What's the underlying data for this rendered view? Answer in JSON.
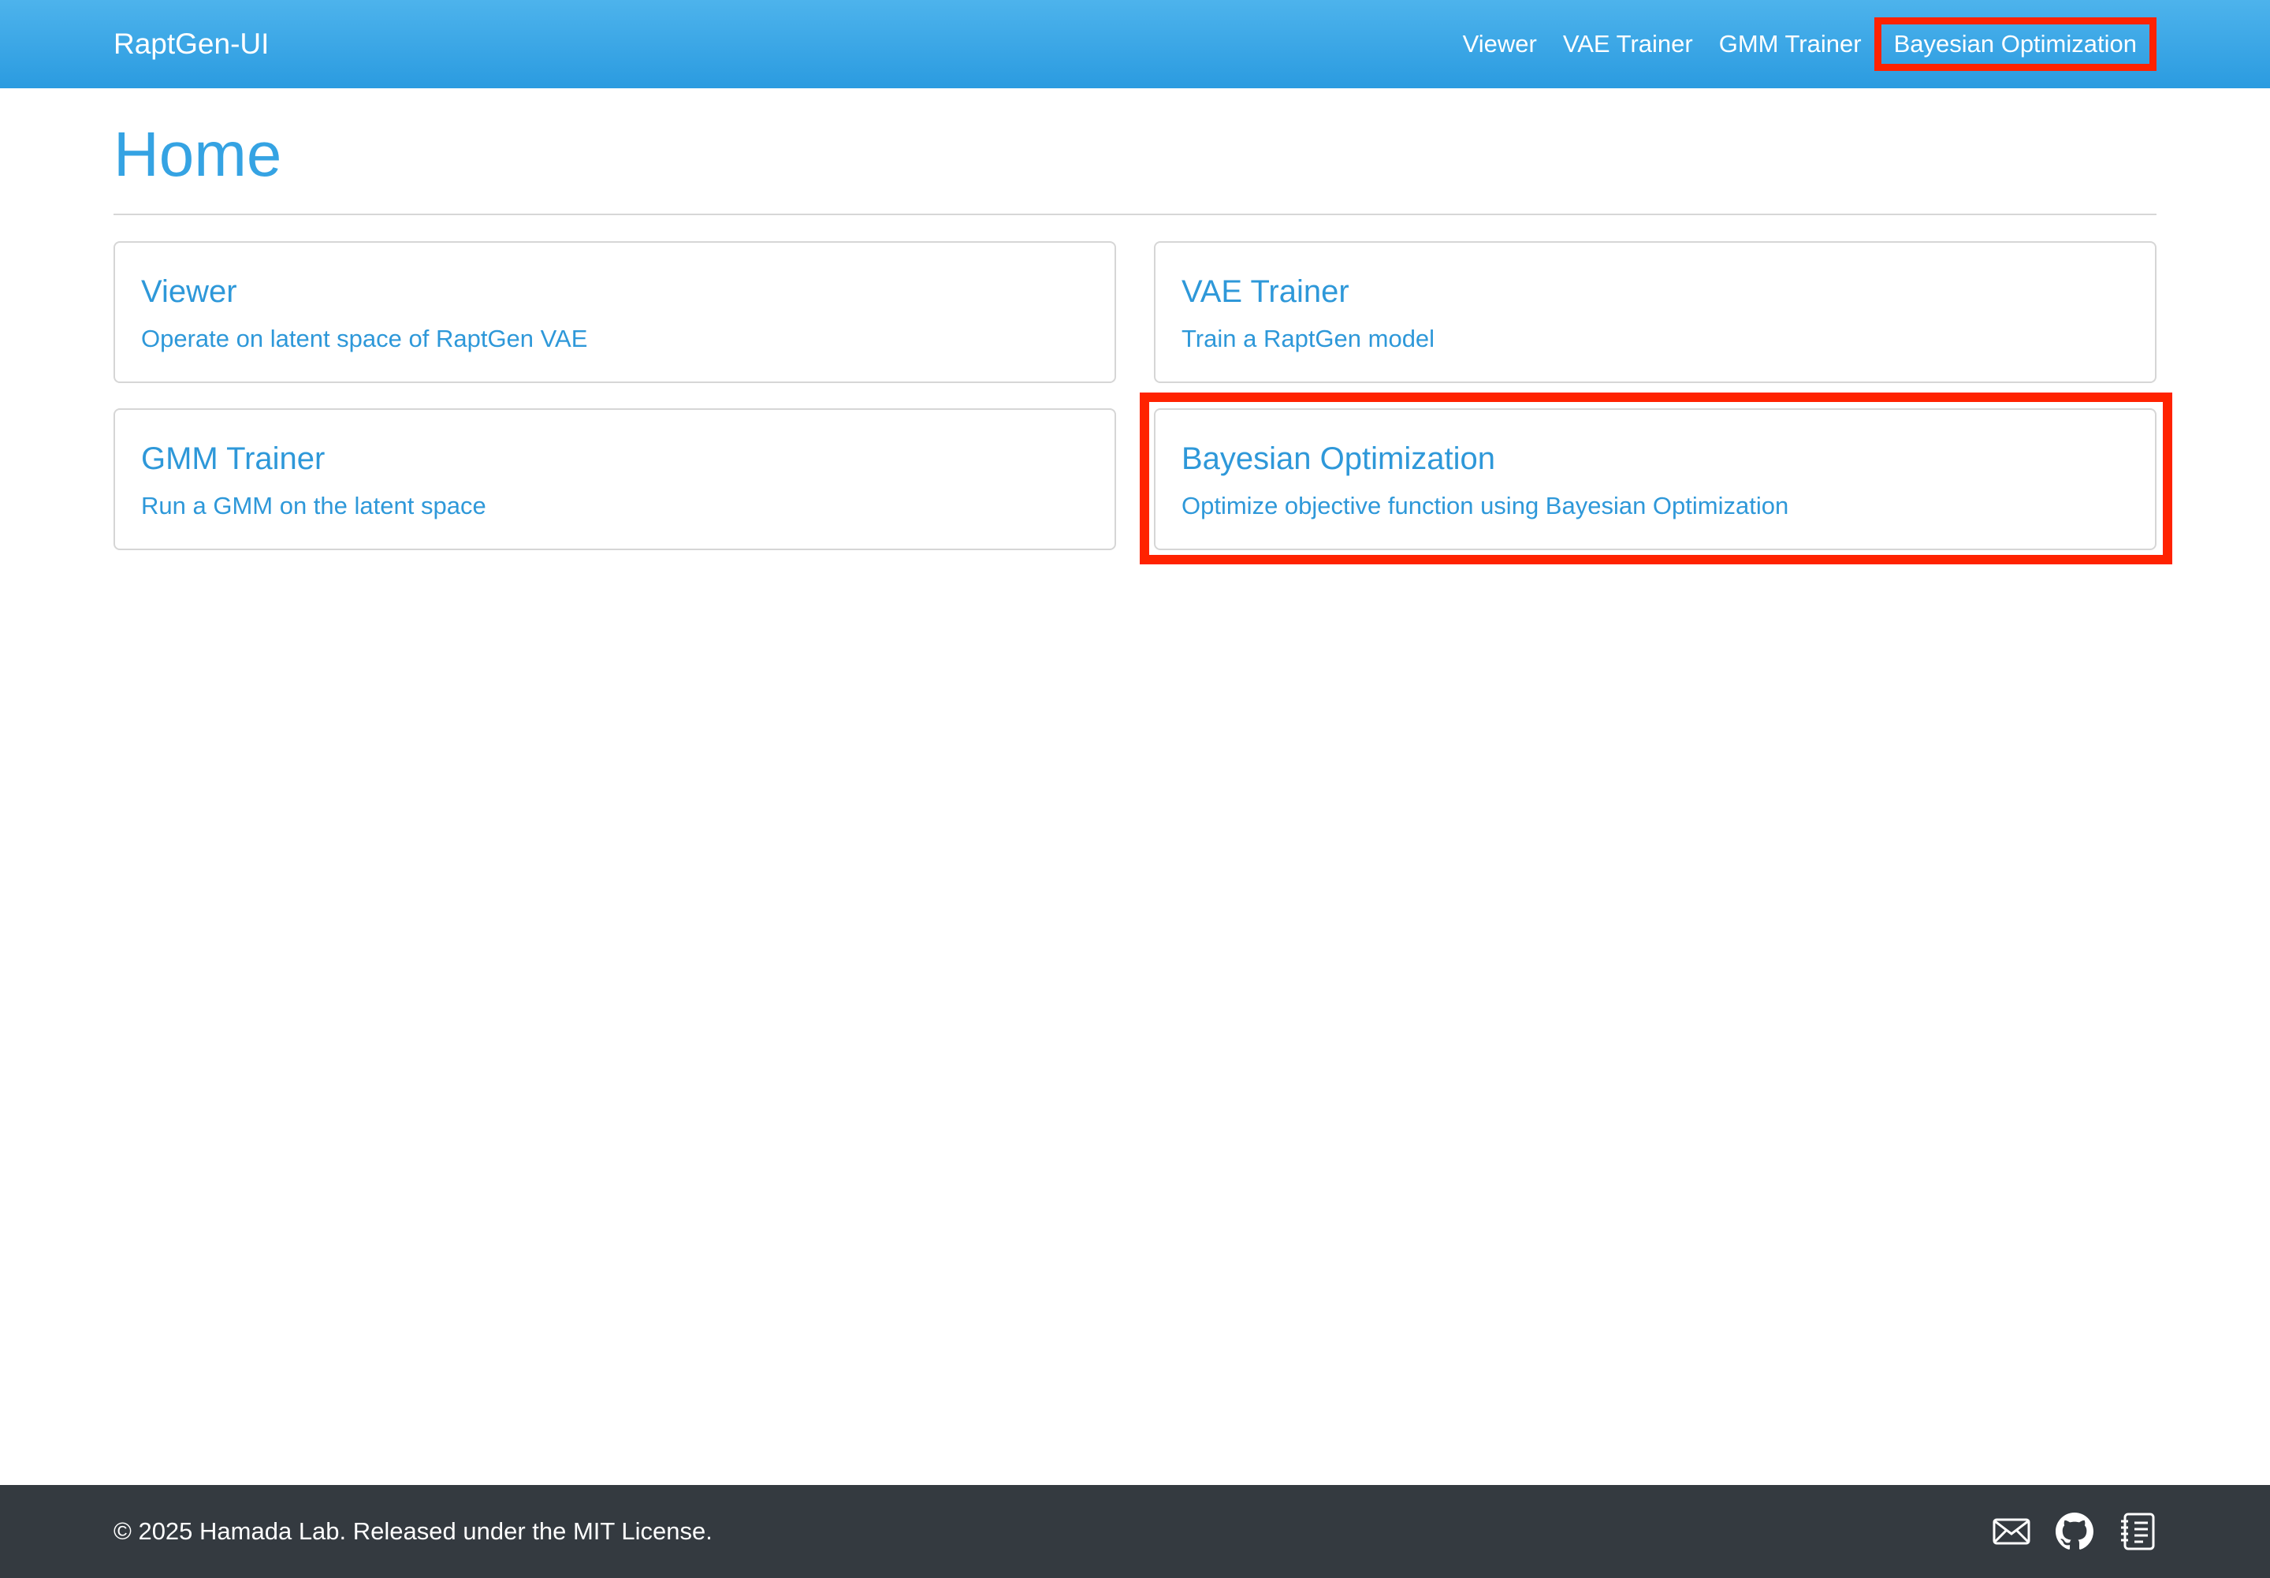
{
  "navbar": {
    "brand": "RaptGen-UI",
    "links": [
      {
        "label": "Viewer"
      },
      {
        "label": "VAE Trainer"
      },
      {
        "label": "GMM Trainer"
      },
      {
        "label": "Bayesian Optimization"
      }
    ]
  },
  "page": {
    "title": "Home"
  },
  "cards": [
    {
      "title": "Viewer",
      "text": "Operate on latent space of RaptGen VAE"
    },
    {
      "title": "VAE Trainer",
      "text": "Train a RaptGen model"
    },
    {
      "title": "GMM Trainer",
      "text": "Run a GMM on the latent space"
    },
    {
      "title": "Bayesian Optimization",
      "text": "Optimize objective function using Bayesian Optimization"
    }
  ],
  "footer": {
    "copyright": "© 2025 Hamada Lab. Released under the MIT License.",
    "icons": [
      "mail-icon",
      "github-icon",
      "journal-icon"
    ]
  },
  "colors": {
    "navbar": "#2b9be0",
    "accent": "#35a3e3",
    "highlight": "#ff2200",
    "footer": "#343a40"
  }
}
